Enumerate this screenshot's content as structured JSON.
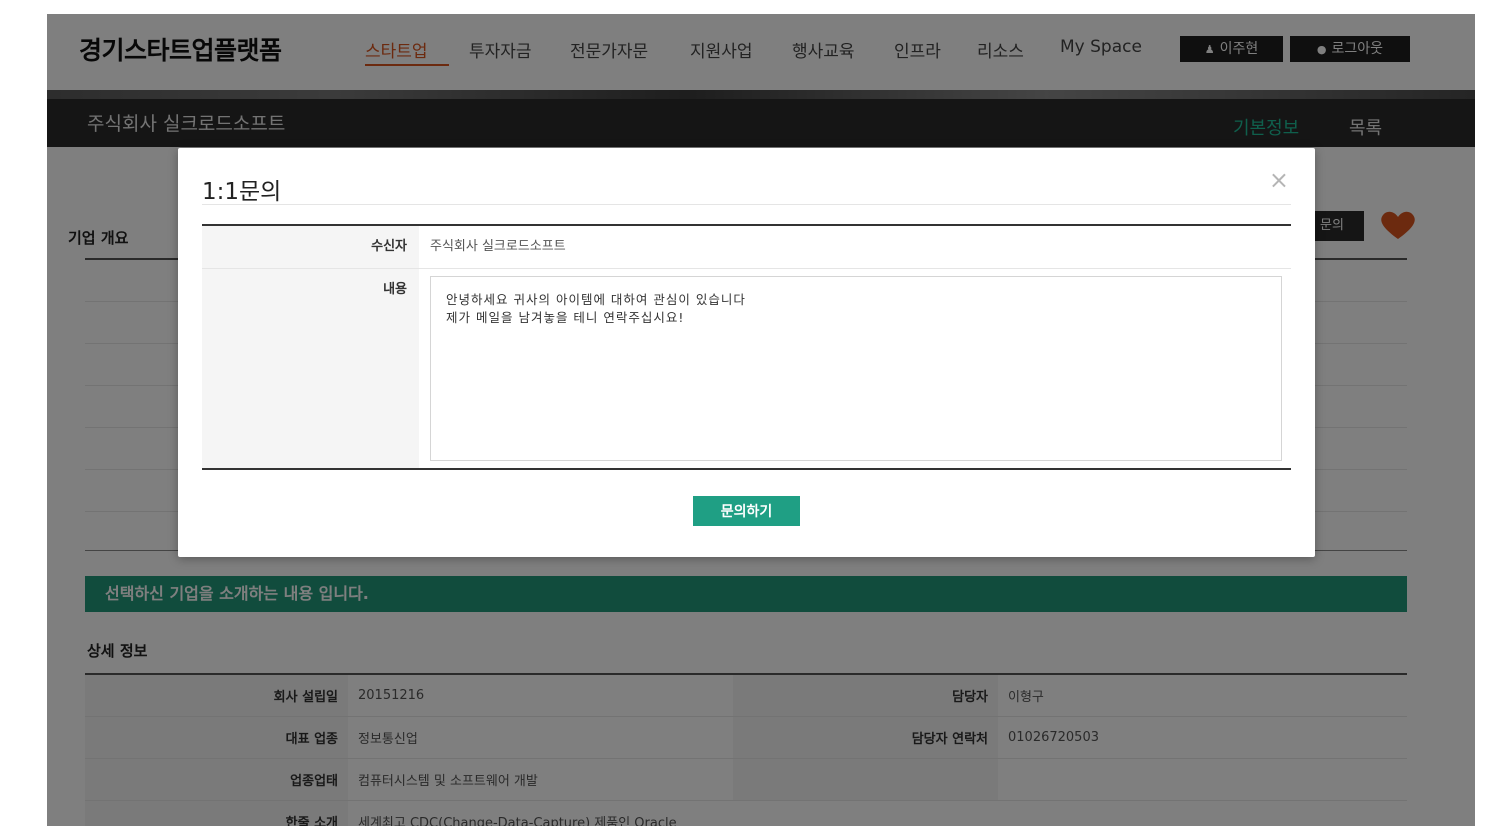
{
  "site": {
    "logo": "경기스타트업플랫폼"
  },
  "nav": {
    "items": [
      "스타트업",
      "투자자금",
      "전문가자문",
      "지원사업",
      "행사교육",
      "인프라",
      "리소스",
      "My Space"
    ],
    "active_index": 0,
    "user_button": "이주현",
    "logout_button": "로그아웃"
  },
  "banner": {
    "company_name": "주식회사 실크로드소프트",
    "link_basic": "기본정보",
    "link_list": "목록"
  },
  "page": {
    "section_title": "기업 개요",
    "inquire_button_partial": "문의",
    "intro_text": "선택하신 기업을 소개하는 내용 입니다.",
    "detail_title": "상세 정보",
    "details": {
      "founded_label": "회사 설립일",
      "founded_value": "20151216",
      "manager_label": "담당자",
      "manager_value": "이형구",
      "industry_label": "대표 업종",
      "industry_value": "정보통신업",
      "contact_label": "담당자 연락처",
      "contact_value": "01026720503",
      "business_label": "업종업태",
      "business_value": "컴퓨터시스템 및 소프트웨어 개발",
      "summary_label": "한줄 소개",
      "summary_value": "세계최고 CDC(Change-Data-Capture) 제품인 Oracle"
    }
  },
  "modal": {
    "title": "1:1문의",
    "close": "×",
    "recipient_label": "수신자",
    "recipient_value": "주식회사 실크로드소프트",
    "content_label": "내용",
    "content_value": "안녕하세요 귀사의 아이템에 대하여 관심이 있습니다\n제가 메일을 남겨놓을 테니 연락주십시요!",
    "submit": "문의하기"
  },
  "colors": {
    "accent_orange": "#d9541e",
    "accent_green": "#22987b",
    "banner_bg": "#2b2b2b",
    "heart": "#d9541e"
  }
}
